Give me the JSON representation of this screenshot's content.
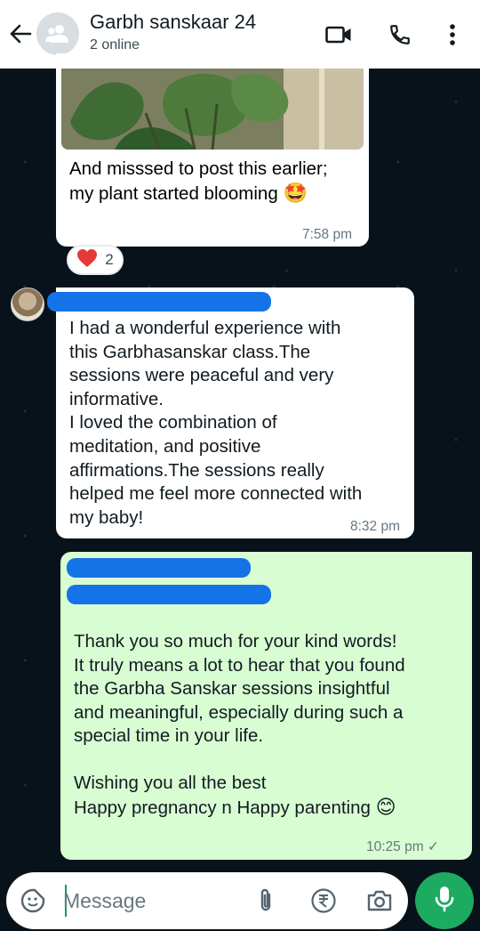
{
  "header": {
    "title": "Garbh sanskaar 24",
    "subtitle": "2 online"
  },
  "messages": [
    {
      "text": "And misssed to post this earlier;\nmy plant started blooming",
      "emoji": "🤩",
      "time": "7:58 pm",
      "reaction": {
        "emoji": "❤️",
        "count": "2"
      }
    },
    {
      "text": "I had a wonderful experience with\nthis Garbhasanskar class.The\nsessions were peaceful and very\ninformative.\nI loved the combination of\nmeditation, and positive\naffirmations.The sessions really\nhelped me feel more connected with\nmy baby!",
      "time": "8:32 pm"
    },
    {
      "text": "Thank you so much for your kind words!\nIt truly means a lot to hear that you found\nthe Garbha Sanskar sessions insightful\nand meaningful, especially during such a\nspecial time in your life.",
      "text2": "Wishing you all the best\nHappy pregnancy n Happy parenting",
      "emoji": "😊",
      "time": "10:25 pm",
      "status": "✓"
    }
  ],
  "input": {
    "placeholder": "Message"
  },
  "icons": {
    "back": "back-arrow-icon",
    "group": "group-avatar-icon",
    "video": "video-call-icon",
    "call": "phone-icon",
    "menu": "more-vert-icon",
    "sticker": "sticker-icon",
    "attach": "attach-icon",
    "payment": "rupee-icon",
    "camera": "camera-icon",
    "mic": "mic-icon"
  },
  "colors": {
    "outgoing_bubble": "#d9fdd3",
    "incoming_bubble": "#ffffff",
    "accent_green": "#1dab61",
    "redaction_blue": "#1473e6"
  }
}
